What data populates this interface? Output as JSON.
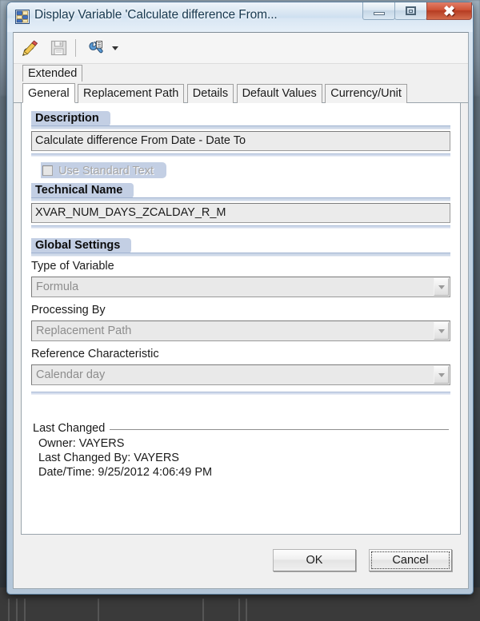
{
  "window": {
    "title": "Display Variable 'Calculate difference From...",
    "icon": "variable-grid-icon",
    "minimize_label": "Minimize",
    "maximize_label": "Maximize",
    "close_label": "Close"
  },
  "toolbar": {
    "items": [
      {
        "name": "display-change-icon",
        "tooltip": "Display ↔ Change"
      },
      {
        "name": "save-icon",
        "tooltip": "Save"
      },
      {
        "name": "tools-icon",
        "tooltip": "Tools"
      }
    ],
    "dropdown_arrow": "chevron-down-icon"
  },
  "outer_tabs": [
    {
      "label": "Extended",
      "active": false
    }
  ],
  "inner_tabs": [
    {
      "label": "General",
      "active": true
    },
    {
      "label": "Replacement Path",
      "active": false
    },
    {
      "label": "Details",
      "active": false
    },
    {
      "label": "Default Values",
      "active": false
    },
    {
      "label": "Currency/Unit",
      "active": false
    }
  ],
  "general": {
    "description_section": "Description",
    "description_value": "Calculate difference From Date - Date To",
    "use_standard_text_label": "Use Standard Text",
    "use_standard_text_checked": false,
    "technical_name_section": "Technical Name",
    "technical_name_value": "XVAR_NUM_DAYS_ZCALDAY_R_M",
    "global_settings_section": "Global Settings",
    "type_of_variable_label": "Type of Variable",
    "type_of_variable_value": "Formula",
    "processing_by_label": "Processing By",
    "processing_by_value": "Replacement Path",
    "reference_characteristic_label": "Reference Characteristic",
    "reference_characteristic_value": "Calendar day"
  },
  "last_changed": {
    "group_label": "Last Changed",
    "owner": "Owner: VAYERS",
    "changed_by": "Last Changed By: VAYERS",
    "date_time": "Date/Time: 9/25/2012 4:06:49 PM"
  },
  "footer": {
    "ok_label": "OK",
    "cancel_label": "Cancel"
  },
  "colors": {
    "section_tab_bg": "#c3cfe4",
    "title_text": "#17384f",
    "close_button": "#cf5437",
    "disabled_text": "#8d8d8d"
  }
}
